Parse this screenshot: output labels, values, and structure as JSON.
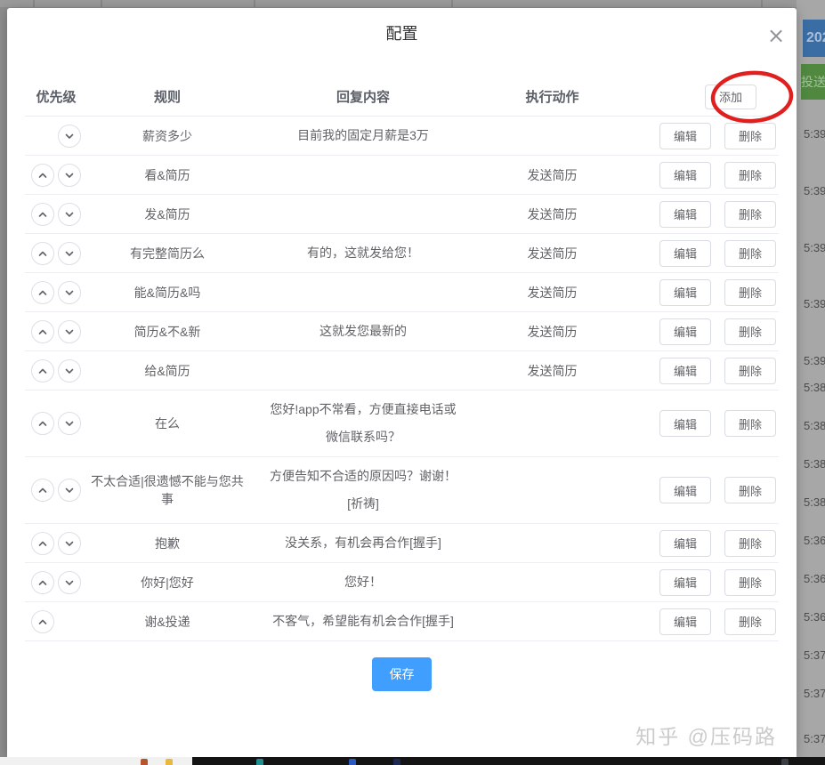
{
  "dialog": {
    "title": "配置",
    "close_glyph": "×",
    "add_button": "添加",
    "save_button": "保存",
    "columns": {
      "priority": "优先级",
      "rule": "规则",
      "reply": "回复内容",
      "action": "执行动作"
    },
    "row_actions": {
      "edit": "编辑",
      "delete": "删除"
    },
    "rules": [
      {
        "rule": "薪资多少",
        "reply": "目前我的固定月薪是3万",
        "action": "",
        "up": false,
        "down": true
      },
      {
        "rule": "看&简历",
        "reply": "",
        "action": "发送简历",
        "up": true,
        "down": true
      },
      {
        "rule": "发&简历",
        "reply": "",
        "action": "发送简历",
        "up": true,
        "down": true
      },
      {
        "rule": "有完整简历么",
        "reply": "有的，这就发给您！",
        "action": "发送简历",
        "up": true,
        "down": true
      },
      {
        "rule": "能&简历&吗",
        "reply": "",
        "action": "发送简历",
        "up": true,
        "down": true
      },
      {
        "rule": "简历&不&新",
        "reply": "这就发您最新的",
        "action": "发送简历",
        "up": true,
        "down": true
      },
      {
        "rule": "给&简历",
        "reply": "",
        "action": "发送简历",
        "up": true,
        "down": true
      },
      {
        "rule": "在么",
        "reply": "您好!app不常看，方便直接电话或微信联系吗？",
        "action": "",
        "up": true,
        "down": true
      },
      {
        "rule": "不太合适|很遗憾不能与您共事",
        "reply": "方便告知不合适的原因吗？谢谢！[祈祷]",
        "action": "",
        "up": true,
        "down": true
      },
      {
        "rule": "抱歉",
        "reply": "没关系，有机会再合作[握手]",
        "action": "",
        "up": true,
        "down": true
      },
      {
        "rule": "你好|您好",
        "reply": "您好！",
        "action": "",
        "up": true,
        "down": true
      },
      {
        "rule": "谢&投递",
        "reply": "不客气，希望能有机会合作[握手]",
        "action": "",
        "up": true,
        "down": false
      }
    ]
  },
  "background": {
    "date_badge": "202",
    "send_badge": "投送",
    "timestamps": [
      "5:39",
      "5:39",
      "5:39",
      "5:39",
      "5:39",
      "5:38",
      "5:38",
      "5:38",
      "5:38",
      "5:36",
      "5:36",
      "5:36",
      "5:37",
      "5:37",
      "5:37"
    ]
  },
  "watermark": "知乎 @压码路",
  "colors": {
    "accent_blue": "#409eff",
    "annotation_red": "#e01f1f",
    "badge_blue": "#3a6da3",
    "badge_green": "#508840"
  }
}
